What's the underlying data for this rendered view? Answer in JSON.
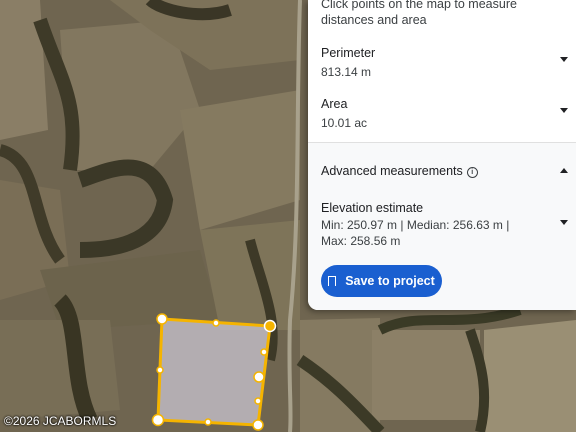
{
  "panel": {
    "hint": "Click points on the map to measure distances and area",
    "perimeter": {
      "label": "Perimeter",
      "value": "813.14 m"
    },
    "area": {
      "label": "Area",
      "value": "10.01 ac"
    },
    "advanced": {
      "label": "Advanced measurements",
      "elevation_label": "Elevation estimate",
      "elevation_value": "Min: 250.97 m | Median: 256.63 m | Max: 258.56 m"
    },
    "save_button": "Save to project"
  },
  "watermark": "©2026 JCABORMLS",
  "colors": {
    "accent": "#1a5fd0",
    "polygon": "#f5b400"
  },
  "icons": [
    "map-pin-icon",
    "info-icon",
    "chevron-down-icon",
    "chevron-up-icon",
    "bookmark-icon"
  ]
}
